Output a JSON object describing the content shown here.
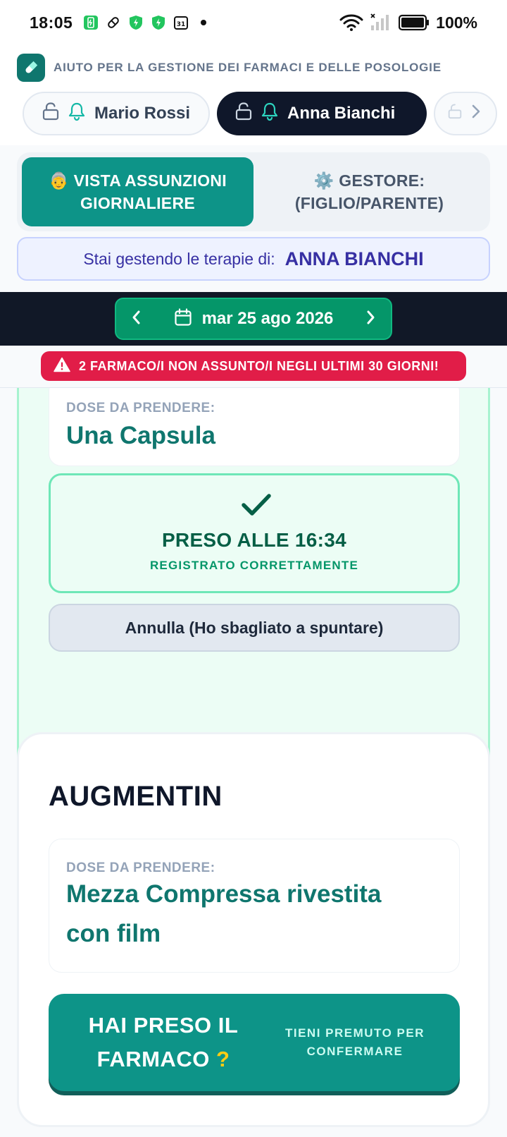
{
  "status_bar": {
    "time": "18:05",
    "battery": "100%",
    "icons": [
      "phone-charge-icon",
      "pill-icon",
      "shield-icon",
      "shield-icon",
      "calendar-icon",
      "dot-icon",
      "wifi-icon",
      "signal-icon",
      "battery-icon"
    ]
  },
  "header": {
    "brand": "AIUTO PER LA GESTIONE DEI FARMACI E DELLE POSOLOGIE",
    "profiles": [
      {
        "name": "Mario Rossi",
        "active": false
      },
      {
        "name": "Anna Bianchi",
        "active": true
      }
    ]
  },
  "mode": {
    "patient_icon": "👵",
    "patient_line1": "VISTA ASSUNZIONI",
    "patient_line2": "GIORNALIERE",
    "manager_icon": "⚙️",
    "manager_line1": "GESTORE:",
    "manager_line2": "(FIGLIO/PARENTE)"
  },
  "managing": {
    "label": "Stai gestendo le terapie di:",
    "name": "ANNA BIANCHI"
  },
  "date_nav": {
    "date": "mar 25 ago 2026"
  },
  "alert": {
    "text": "2 FARMACO/I NON ASSUNTO/I NEGLI ULTIMI 30 GIORNI!"
  },
  "taken_card": {
    "dose_label": "DOSE DA PRENDERE:",
    "dose_value": "Una Capsula",
    "taken_title": "PRESO ALLE 16:34",
    "taken_sub": "REGISTRATO CORRETTAMENTE",
    "undo_label": "Annulla (Ho sbagliato a spuntare)"
  },
  "pending_card": {
    "name": "AUGMENTIN",
    "dose_label": "DOSE DA PRENDERE:",
    "dose_line1": "Mezza Compressa rivestita",
    "dose_line2": "con film",
    "confirm_line1": "HAI PRESO IL",
    "confirm_line2": "FARMACO",
    "confirm_q": "?",
    "hint_line1": "TIENI PREMUTO PER",
    "hint_line2": "CONFERMARE"
  },
  "colors": {
    "primary": "#0d9488",
    "dark": "#0f172a",
    "alert": "#e11d48",
    "date_green": "#059669",
    "indigo": "#3730a3"
  }
}
